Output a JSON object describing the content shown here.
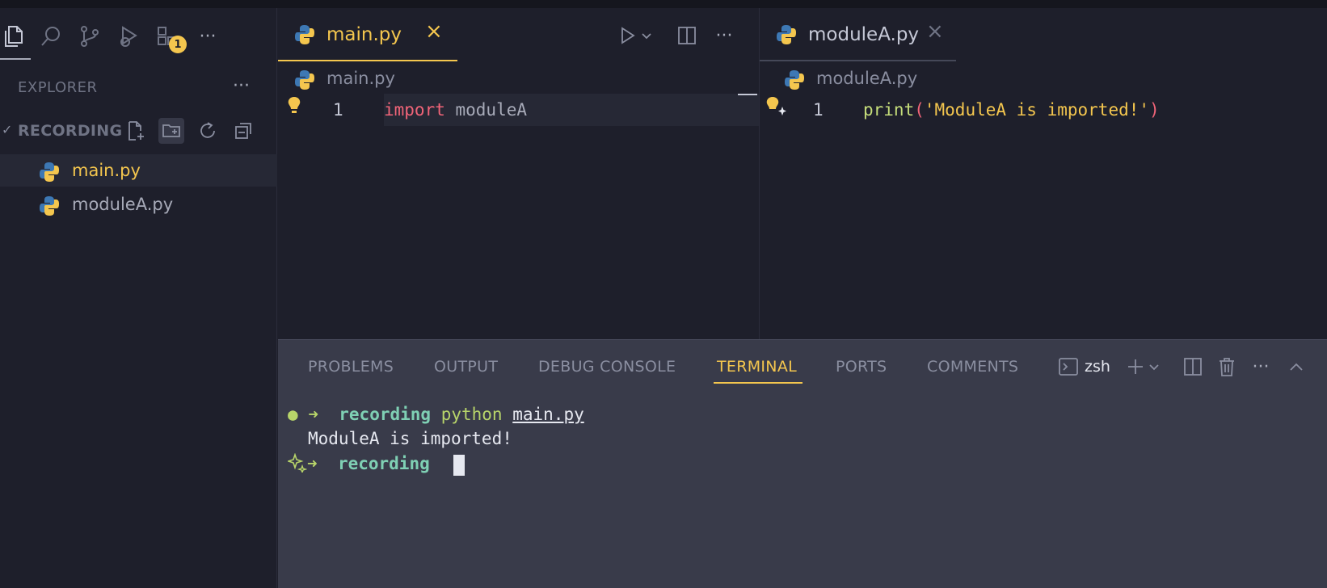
{
  "activity_bar": {
    "icons": [
      "explorer-icon",
      "search-icon",
      "source-control-icon",
      "run-debug-icon",
      "extensions-icon"
    ],
    "extensions_badge": "1",
    "more": "···"
  },
  "explorer": {
    "title": "EXPLORER",
    "more": "···",
    "folder": {
      "name": "RECORDING",
      "chevron": "✓",
      "actions": [
        "new-file-icon",
        "new-folder-icon",
        "refresh-icon",
        "collapse-all-icon"
      ]
    },
    "files": [
      {
        "name": "main.py",
        "active": true
      },
      {
        "name": "moduleA.py",
        "active": false
      }
    ]
  },
  "editor_left": {
    "tab_label": "main.py",
    "close": "×",
    "more": "···",
    "breadcrumb": "main.py",
    "line_number": "1",
    "code_keyword": "import",
    "code_rest": " moduleA"
  },
  "editor_right": {
    "tab_label": "moduleA.py",
    "close": "×",
    "breadcrumb": "moduleA.py",
    "line_number": "1",
    "code_fn": "print",
    "code_open": "(",
    "code_string": "'ModuleA is imported!'",
    "code_close": ")"
  },
  "panel": {
    "tabs": [
      "PROBLEMS",
      "OUTPUT",
      "DEBUG CONSOLE",
      "TERMINAL",
      "PORTS",
      "COMMENTS"
    ],
    "active_tab": "TERMINAL",
    "shell": "zsh",
    "more": "···",
    "terminal": {
      "line1_dot": "●",
      "line1_arrow": "➜",
      "line1_dir": "recording",
      "line1_cmd": "python",
      "line1_arg": "main.py",
      "line2_output": "ModuleA is imported!",
      "line3_arrow": "➜",
      "line3_dir": "recording"
    }
  },
  "colors": {
    "accent": "#f4c64e",
    "background": "#1e1f2b",
    "panel": "#393b4a"
  }
}
